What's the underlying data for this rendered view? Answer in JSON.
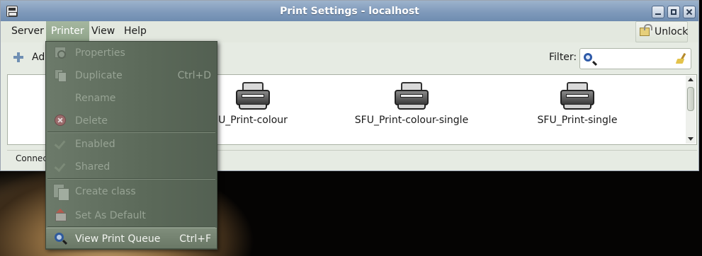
{
  "window": {
    "title": "Print Settings - localhost"
  },
  "menubar": {
    "items": [
      {
        "label": "Server"
      },
      {
        "label": "Printer"
      },
      {
        "label": "View"
      },
      {
        "label": "Help"
      }
    ],
    "unlock_label": "Unlock"
  },
  "toolbar": {
    "add_label": "Add",
    "filter_label": "Filter:",
    "filter_value": ""
  },
  "printers": [
    {
      "name": "SFU_Print-colour",
      "visible_label": "U_Print-colour",
      "icon": "printer-icon"
    },
    {
      "name": "SFU_Print-colour-single",
      "visible_label": "SFU_Print-colour-single",
      "icon": "printer-icon"
    },
    {
      "name": "SFU_Print-single",
      "visible_label": "SFU_Print-single",
      "icon": "printer-icon"
    }
  ],
  "status": {
    "text": "Connec"
  },
  "printer_menu": {
    "items": [
      {
        "label": "Properties",
        "accel": "",
        "icon": "properties-icon",
        "enabled": false
      },
      {
        "label": "Duplicate",
        "accel": "Ctrl+D",
        "icon": "duplicate-icon",
        "enabled": false
      },
      {
        "label": "Rename",
        "accel": "",
        "icon": "",
        "enabled": false
      },
      {
        "label": "Delete",
        "accel": "",
        "icon": "delete-icon",
        "enabled": false
      },
      {
        "label": "Enabled",
        "accel": "",
        "icon": "check-icon",
        "enabled": false
      },
      {
        "label": "Shared",
        "accel": "",
        "icon": "check-icon",
        "enabled": false
      },
      {
        "label": "Create class",
        "accel": "",
        "icon": "class-icon",
        "enabled": false
      },
      {
        "label": "Set As Default",
        "accel": "",
        "icon": "set-default-icon",
        "enabled": false
      },
      {
        "label": "View Print Queue",
        "accel": "Ctrl+F",
        "icon": "search-icon",
        "enabled": true,
        "highlighted": true
      }
    ]
  },
  "colors": {
    "titlebar": "#7f9abb",
    "window_bg": "#e6ebe3",
    "menu_bg": "#5b6959",
    "menu_highlight": "#7f8d7b",
    "active_menu": "#98ab93"
  }
}
